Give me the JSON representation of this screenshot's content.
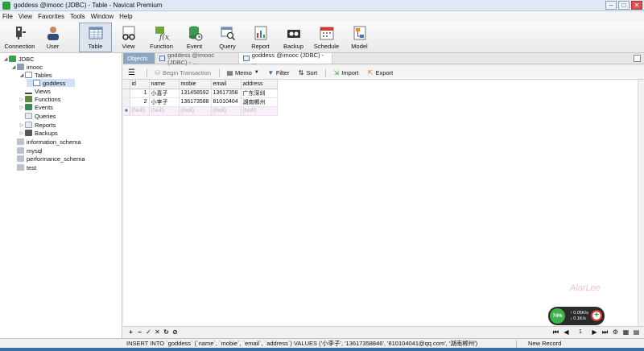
{
  "window": {
    "title": "goddess @imooc (JDBC) - Table - Navicat Premium"
  },
  "menu": [
    "File",
    "View",
    "Favorites",
    "Tools",
    "Window",
    "Help"
  ],
  "toolbar": [
    "Connection",
    "User",
    "Table",
    "View",
    "Function",
    "Event",
    "Query",
    "Report",
    "Backup",
    "Schedule",
    "Model"
  ],
  "sidebar": {
    "items": [
      {
        "label": "JDBC",
        "level": 0,
        "expander": "◢",
        "icon": "database-connection-icon",
        "color": "#3aa14a"
      },
      {
        "label": "imooc",
        "level": 1,
        "expander": "◢",
        "icon": "database-icon",
        "color": "#8a9db5"
      },
      {
        "label": "Tables",
        "level": 2,
        "expander": "◢",
        "icon": "tables-icon",
        "color": "#6f8fb8"
      },
      {
        "label": "goddess",
        "level": 3,
        "expander": "",
        "icon": "table-icon",
        "color": "#6f8fb8"
      },
      {
        "label": "Views",
        "level": 2,
        "expander": "",
        "icon": "views-icon",
        "color": "#444"
      },
      {
        "label": "Functions",
        "level": 2,
        "expander": "▷",
        "icon": "functions-icon",
        "color": "#5b8a3a"
      },
      {
        "label": "Events",
        "level": 2,
        "expander": "▷",
        "icon": "events-icon",
        "color": "#3c8a4f"
      },
      {
        "label": "Queries",
        "level": 2,
        "expander": "",
        "icon": "queries-icon",
        "color": "#9aa6b8"
      },
      {
        "label": "Reports",
        "level": 2,
        "expander": "▷",
        "icon": "reports-icon",
        "color": "#9aa6b8"
      },
      {
        "label": "Backups",
        "level": 2,
        "expander": "▷",
        "icon": "backups-icon",
        "color": "#555"
      },
      {
        "label": "information_schema",
        "level": 1,
        "expander": "",
        "icon": "database-icon",
        "color": "#b9c3cf"
      },
      {
        "label": "mysql",
        "level": 1,
        "expander": "",
        "icon": "database-icon",
        "color": "#b9c3cf"
      },
      {
        "label": "performance_schema",
        "level": 1,
        "expander": "",
        "icon": "database-icon",
        "color": "#b9c3cf"
      },
      {
        "label": "test",
        "level": 1,
        "expander": "",
        "icon": "database-icon",
        "color": "#b9c3cf"
      }
    ]
  },
  "tabs": {
    "objects": "Objects",
    "tab1": "goddess @imooc (JDBC) - ...",
    "tab2": "goddess @imooc (JDBC) - ..."
  },
  "subtoolbar": {
    "begin_transaction": "Begin Transaction",
    "memo": "Memo",
    "filter": "Filter",
    "sort": "Sort",
    "import": "Import",
    "export": "Export"
  },
  "grid": {
    "columns": [
      "id",
      "name",
      "mobie",
      "email",
      "address"
    ],
    "rows": [
      [
        "1",
        "小喜子",
        "131458592",
        "13617358",
        "广东深圳"
      ],
      [
        "2",
        "小李子",
        "136173588",
        "81010404",
        "湖南郴州"
      ]
    ],
    "new_row": [
      "(Null)",
      "(Null)",
      "(Null)",
      "(Null)",
      "(Null)"
    ]
  },
  "bottomnav": {
    "page": "1"
  },
  "status": {
    "sql": "INSERT INTO `goddess` (`name`, `mobie`, `email`, `address`) VALUES ('小李子', '13617358846', '810104041@qq.com', '湖南郴州')",
    "mode": "New Record"
  },
  "watermark": "AlarLee",
  "netwidget": {
    "percent": "74%",
    "up": "0.05K/s",
    "down": "0.1K/s"
  }
}
